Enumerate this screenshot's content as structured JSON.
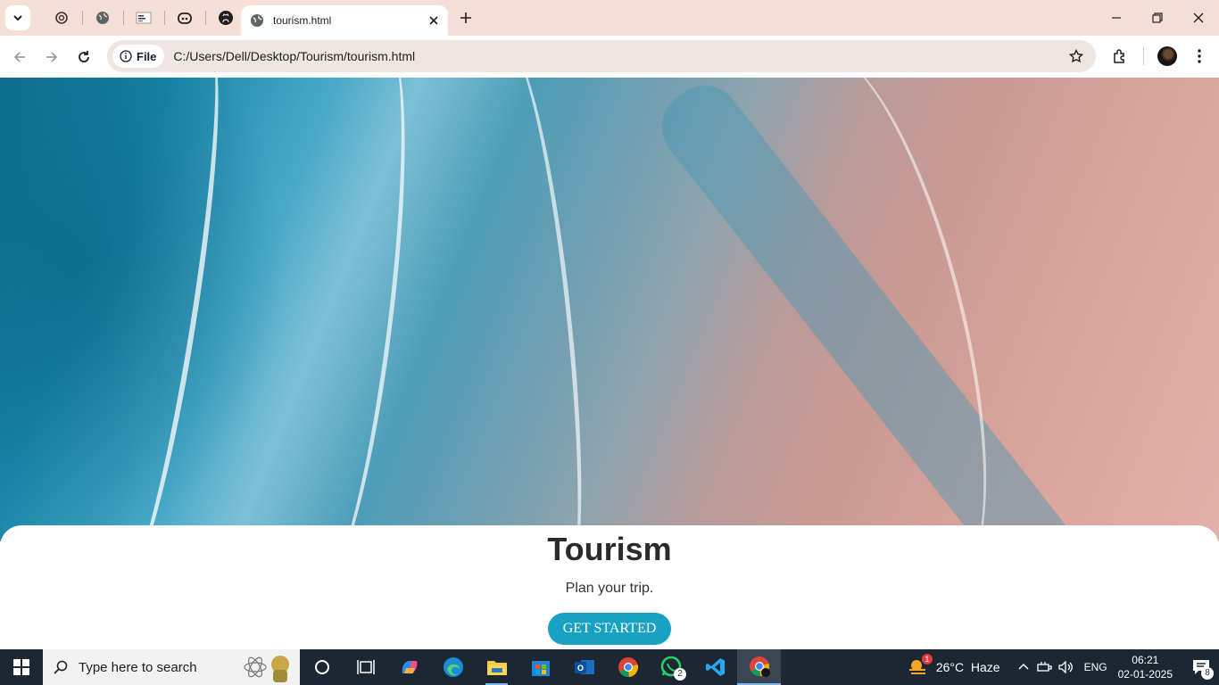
{
  "browser": {
    "active_tab_title": "tourism.html",
    "address_chip": "File",
    "url": "C:/Users/Dell/Desktop/Tourism/tourism.html"
  },
  "page": {
    "heading": "Tourism",
    "tagline": "Plan your trip.",
    "cta_label": "GET STARTED",
    "accent_color": "#17a2c4"
  },
  "taskbar": {
    "search_placeholder": "Type here to search",
    "whatsapp_badge": "2",
    "weather_alert": "1",
    "weather_text": "26°C  Haze",
    "language": "ENG",
    "time": "06:21",
    "date": "02-01-2025",
    "notifications": "8"
  }
}
